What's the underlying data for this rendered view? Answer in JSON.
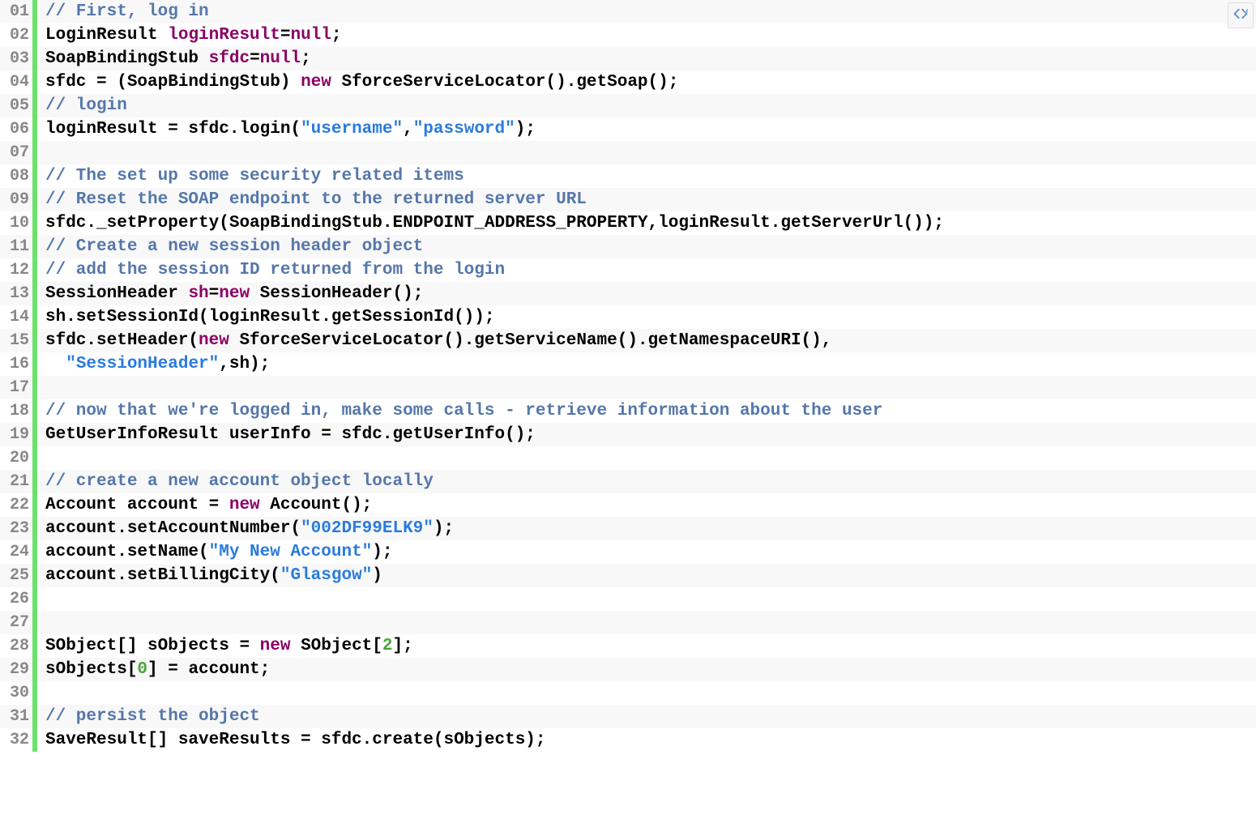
{
  "toggle_icon_name": "code-toggle-icon",
  "lines": [
    {
      "num": "01",
      "tokens": [
        {
          "t": "// First, log in",
          "c": "comment"
        }
      ]
    },
    {
      "num": "02",
      "tokens": [
        {
          "t": "LoginResult ",
          "c": "type"
        },
        {
          "t": "loginResult",
          "c": "var"
        },
        {
          "t": "=",
          "c": "type"
        },
        {
          "t": "null",
          "c": "kw"
        },
        {
          "t": ";",
          "c": "type"
        }
      ]
    },
    {
      "num": "03",
      "tokens": [
        {
          "t": "SoapBindingStub ",
          "c": "type"
        },
        {
          "t": "sfdc",
          "c": "var"
        },
        {
          "t": "=",
          "c": "type"
        },
        {
          "t": "null",
          "c": "kw"
        },
        {
          "t": ";",
          "c": "type"
        }
      ]
    },
    {
      "num": "04",
      "tokens": [
        {
          "t": "sfdc = (SoapBindingStub) ",
          "c": "type"
        },
        {
          "t": "new",
          "c": "kw"
        },
        {
          "t": " SforceServiceLocator().getSoap();",
          "c": "type"
        }
      ]
    },
    {
      "num": "05",
      "tokens": [
        {
          "t": "// login",
          "c": "comment"
        }
      ]
    },
    {
      "num": "06",
      "tokens": [
        {
          "t": "loginResult = sfdc.login(",
          "c": "type"
        },
        {
          "t": "\"username\"",
          "c": "str"
        },
        {
          "t": ",",
          "c": "type"
        },
        {
          "t": "\"password\"",
          "c": "str"
        },
        {
          "t": ");",
          "c": "type"
        }
      ]
    },
    {
      "num": "07",
      "tokens": []
    },
    {
      "num": "08",
      "tokens": [
        {
          "t": "// The set up some security related items",
          "c": "comment"
        }
      ]
    },
    {
      "num": "09",
      "tokens": [
        {
          "t": "// Reset the SOAP endpoint to the returned server URL",
          "c": "comment"
        }
      ]
    },
    {
      "num": "10",
      "tokens": [
        {
          "t": "sfdc._setProperty(SoapBindingStub.ENDPOINT_ADDRESS_PROPERTY,loginResult.getServerUrl());",
          "c": "type"
        }
      ]
    },
    {
      "num": "11",
      "tokens": [
        {
          "t": "// Create a new session header object",
          "c": "comment"
        }
      ]
    },
    {
      "num": "12",
      "tokens": [
        {
          "t": "// add the session ID returned from the login",
          "c": "comment"
        }
      ]
    },
    {
      "num": "13",
      "tokens": [
        {
          "t": "SessionHeader ",
          "c": "type"
        },
        {
          "t": "sh",
          "c": "var"
        },
        {
          "t": "=",
          "c": "type"
        },
        {
          "t": "new",
          "c": "kw"
        },
        {
          "t": " SessionHeader();",
          "c": "type"
        }
      ]
    },
    {
      "num": "14",
      "tokens": [
        {
          "t": "sh.setSessionId(loginResult.getSessionId());",
          "c": "type"
        }
      ]
    },
    {
      "num": "15",
      "tokens": [
        {
          "t": "sfdc.setHeader(",
          "c": "type"
        },
        {
          "t": "new",
          "c": "kw"
        },
        {
          "t": " SforceServiceLocator().getServiceName().getNamespaceURI(),",
          "c": "type"
        }
      ]
    },
    {
      "num": "16",
      "tokens": [
        {
          "t": "  ",
          "c": "type"
        },
        {
          "t": "\"SessionHeader\"",
          "c": "str"
        },
        {
          "t": ",sh);",
          "c": "type"
        }
      ]
    },
    {
      "num": "17",
      "tokens": []
    },
    {
      "num": "18",
      "tokens": [
        {
          "t": "// now that we're logged in, make some calls - retrieve information about the user",
          "c": "comment"
        }
      ]
    },
    {
      "num": "19",
      "tokens": [
        {
          "t": "GetUserInfoResult userInfo = sfdc.getUserInfo();",
          "c": "type"
        }
      ]
    },
    {
      "num": "20",
      "tokens": []
    },
    {
      "num": "21",
      "tokens": [
        {
          "t": "// create a new account object locally",
          "c": "comment"
        }
      ]
    },
    {
      "num": "22",
      "tokens": [
        {
          "t": "Account account = ",
          "c": "type"
        },
        {
          "t": "new",
          "c": "kw"
        },
        {
          "t": " Account();",
          "c": "type"
        }
      ]
    },
    {
      "num": "23",
      "tokens": [
        {
          "t": "account.setAccountNumber(",
          "c": "type"
        },
        {
          "t": "\"002DF99ELK9\"",
          "c": "str"
        },
        {
          "t": ");",
          "c": "type"
        }
      ]
    },
    {
      "num": "24",
      "tokens": [
        {
          "t": "account.setName(",
          "c": "type"
        },
        {
          "t": "\"My New Account\"",
          "c": "str"
        },
        {
          "t": ");",
          "c": "type"
        }
      ]
    },
    {
      "num": "25",
      "tokens": [
        {
          "t": "account.setBillingCity(",
          "c": "type"
        },
        {
          "t": "\"Glasgow\"",
          "c": "str"
        },
        {
          "t": ")",
          "c": "type"
        }
      ]
    },
    {
      "num": "26",
      "tokens": []
    },
    {
      "num": "27",
      "tokens": []
    },
    {
      "num": "28",
      "tokens": [
        {
          "t": "SObject[] sObjects = ",
          "c": "type"
        },
        {
          "t": "new",
          "c": "kw"
        },
        {
          "t": " SObject[",
          "c": "type"
        },
        {
          "t": "2",
          "c": "num"
        },
        {
          "t": "];",
          "c": "type"
        }
      ]
    },
    {
      "num": "29",
      "tokens": [
        {
          "t": "sObjects[",
          "c": "type"
        },
        {
          "t": "0",
          "c": "num"
        },
        {
          "t": "] = account;",
          "c": "type"
        }
      ]
    },
    {
      "num": "30",
      "tokens": []
    },
    {
      "num": "31",
      "tokens": [
        {
          "t": "// persist the object",
          "c": "comment"
        }
      ]
    },
    {
      "num": "32",
      "tokens": [
        {
          "t": "SaveResult[] saveResults = sfdc.create(sObjects);",
          "c": "type"
        }
      ]
    }
  ]
}
